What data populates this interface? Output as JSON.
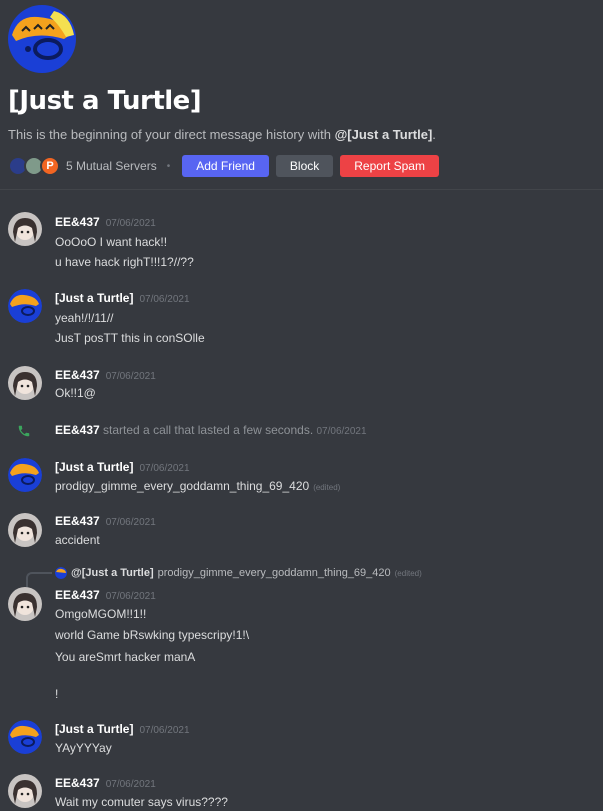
{
  "header": {
    "title": "[Just a Turtle]",
    "intro_prefix": "This is the beginning of your direct message history with ",
    "intro_name": "@[Just a Turtle]",
    "intro_suffix": ".",
    "mutual_servers": "5 Mutual Servers",
    "separator": "•",
    "add_friend": "Add Friend",
    "block": "Block",
    "report_spam": "Report Spam"
  },
  "messages": {
    "m1": {
      "author": "EE&437",
      "time": "07/06/2021",
      "lines": [
        "OoOoO I want hack!!",
        "u have hack righT!!!1?//??"
      ]
    },
    "m2": {
      "author": "[Just a Turtle]",
      "time": "07/06/2021",
      "lines": [
        "yeah!/!/11//",
        "JusT posTT this in conSOlle"
      ]
    },
    "m3": {
      "author": "EE&437",
      "time": "07/06/2021",
      "lines": [
        "Ok!!1@"
      ]
    },
    "call": {
      "author": "EE&437",
      "text": " started a call that lasted a few seconds.",
      "time": "07/06/2021"
    },
    "m4": {
      "author": "[Just a Turtle]",
      "time": "07/06/2021",
      "lines": [
        "prodigy_gimme_every_goddamn_thing_69_420"
      ],
      "edited": "(edited)"
    },
    "m5": {
      "author": "EE&437",
      "time": "07/06/2021",
      "lines": [
        "accident"
      ]
    },
    "reply": {
      "author": "@[Just a Turtle]",
      "text": "prodigy_gimme_every_goddamn_thing_69_420",
      "edited": "(edited)"
    },
    "m6": {
      "author": "EE&437",
      "time": "07/06/2021",
      "lines": [
        "OmgoMGOM!!1!!",
        "world Game  bRswking typescripy!1!\\",
        "You areSmrt hacker manA",
        "!"
      ]
    },
    "m7": {
      "author": "[Just a Turtle]",
      "time": "07/06/2021",
      "lines": [
        "YAyYYYay"
      ]
    },
    "m8": {
      "author": "EE&437",
      "time": "07/06/2021",
      "lines": [
        "Wait my comuter says virus????"
      ]
    }
  },
  "colors": {
    "background": "#36393f",
    "blurple": "#5865f2",
    "danger": "#ed4245",
    "secondary": "#4f545c",
    "call_green": "#3ba55d"
  },
  "icons": {
    "call": "phone-icon",
    "separator_dot": "dot-icon"
  }
}
